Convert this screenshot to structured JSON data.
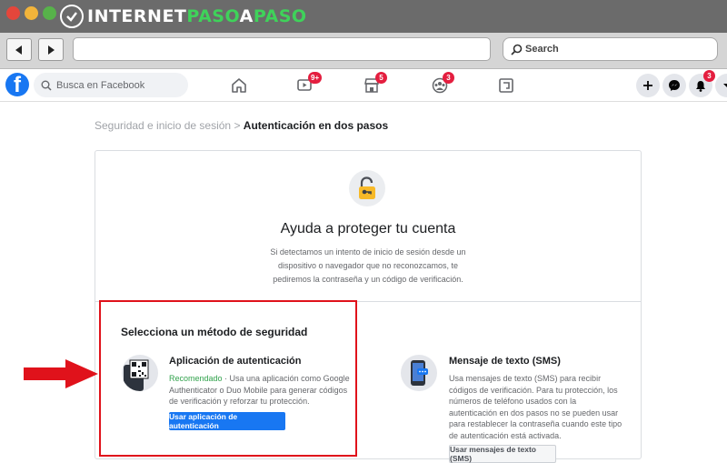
{
  "watermark": {
    "part1": "INTERNET",
    "part2": "PASO",
    "part3": "A",
    "part4": "PASO"
  },
  "browser": {
    "search_placeholder": "Search"
  },
  "facebook": {
    "search_placeholder": "Busca en Facebook",
    "badges": {
      "watch": "9+",
      "marketplace": "5",
      "groups": "3",
      "notifications": "3"
    }
  },
  "breadcrumb": {
    "parent": "Seguridad e inicio de sesión",
    "separator": " > ",
    "current": "Autenticación en dos pasos"
  },
  "card": {
    "heading": "Ayuda a proteger tu cuenta",
    "description": "Si detectamos un intento de inicio de sesión desde un dispositivo o navegador que no reconozcamos, te pediremos la contraseña y un código de verificación.",
    "section_title": "Selecciona un método de seguridad",
    "auth_app": {
      "title": "Aplicación de autenticación",
      "recommended": "Recomendado",
      "description": " · Usa una aplicación como Google Authenticator o Duo Mobile para generar códigos de verificación y reforzar tu protección.",
      "button": "Usar aplicación de autenticación"
    },
    "sms": {
      "title": "Mensaje de texto (SMS)",
      "description": "Usa mensajes de texto (SMS) para recibir códigos de verificación. Para tu protección, los números de teléfono usados con la autenticación en dos pasos no se pueden usar para restablecer la contraseña cuando este tipo de autenticación está activada.",
      "button": "Usar mensajes de texto (SMS)"
    }
  },
  "colors": {
    "facebook_blue": "#1877f2",
    "highlight_red": "#e0121b",
    "recommended_green": "#31a24c"
  }
}
